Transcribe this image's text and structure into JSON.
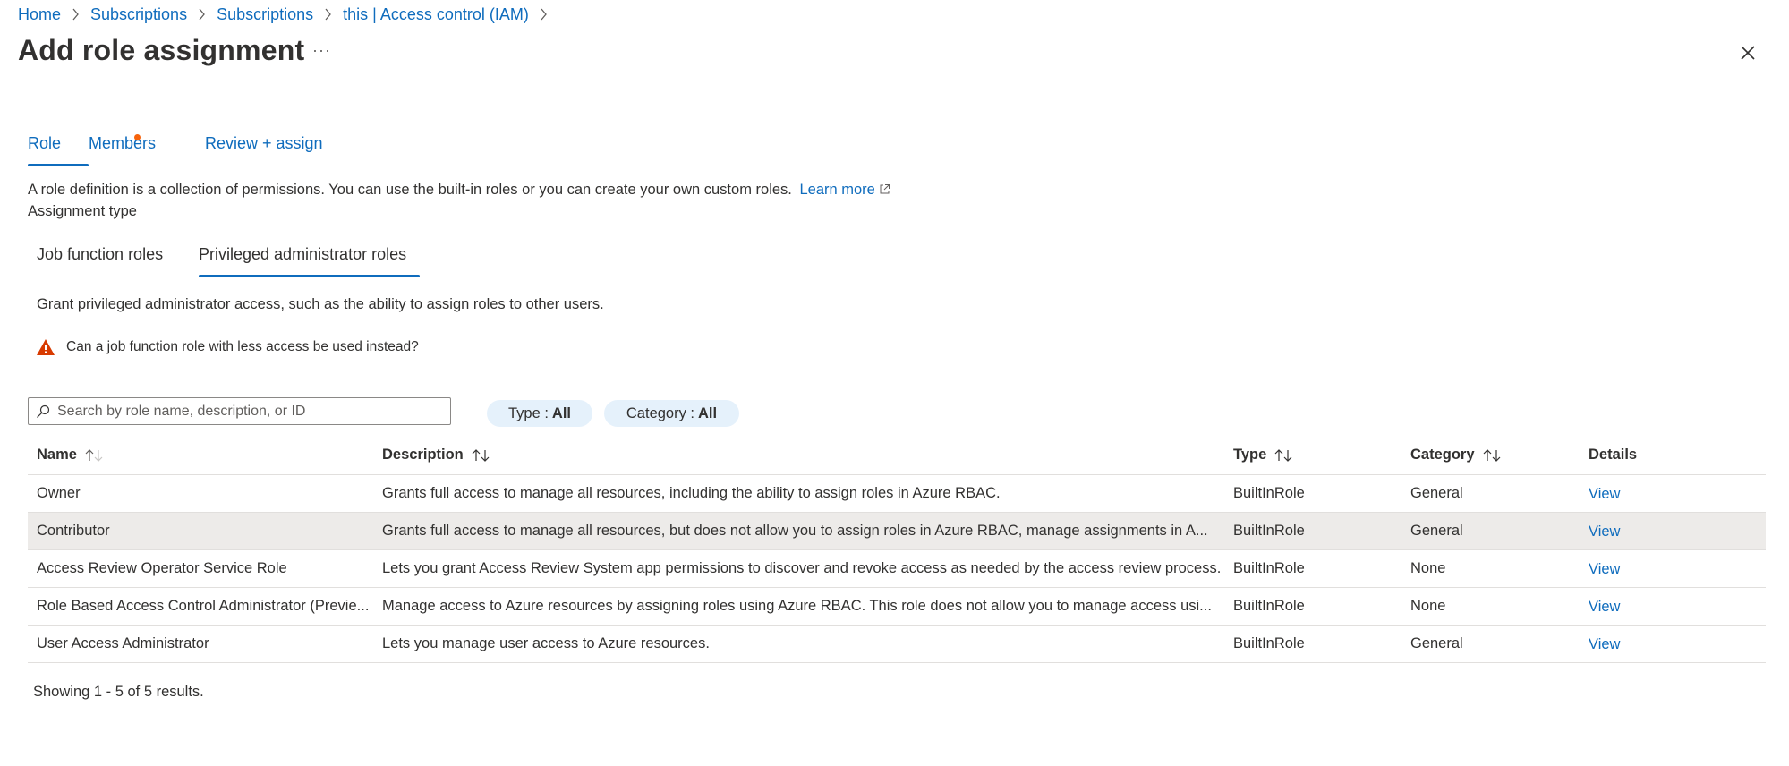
{
  "breadcrumb": {
    "items": [
      "Home",
      "Subscriptions",
      "Subscriptions",
      "this | Access control (IAM)"
    ]
  },
  "page": {
    "title": "Add role assignment",
    "more_label": "···"
  },
  "tabs": [
    {
      "label": "Role",
      "active": true
    },
    {
      "label": "Members",
      "has_indicator": true
    },
    {
      "label": "Review + assign"
    }
  ],
  "description": {
    "text": "A role definition is a collection of permissions. You can use the built-in roles or you can create your own custom roles.",
    "link": "Learn more"
  },
  "assignment_type_label": "Assignment type",
  "subtabs": [
    {
      "label": "Job function roles",
      "active": false
    },
    {
      "label": "Privileged administrator roles",
      "active": true
    }
  ],
  "grant_text": "Grant privileged administrator access, such as the ability to assign roles to other users.",
  "warning_text": "Can a job function role with less access be used instead?",
  "search": {
    "placeholder": "Search by role name, description, or ID",
    "value": ""
  },
  "filters": {
    "type": {
      "label": "Type :",
      "value": "All"
    },
    "category": {
      "label": "Category :",
      "value": "All"
    }
  },
  "table": {
    "headers": {
      "name": "Name",
      "description": "Description",
      "type": "Type",
      "category": "Category",
      "details": "Details"
    },
    "rows": [
      {
        "name": "Owner",
        "description": "Grants full access to manage all resources, including the ability to assign roles in Azure RBAC.",
        "type": "BuiltInRole",
        "category": "General",
        "details": "View"
      },
      {
        "name": "Contributor",
        "description": "Grants full access to manage all resources, but does not allow you to assign roles in Azure RBAC, manage assignments in A...",
        "type": "BuiltInRole",
        "category": "General",
        "details": "View",
        "selected": true
      },
      {
        "name": "Access Review Operator Service Role",
        "description": "Lets you grant Access Review System app permissions to discover and revoke access as needed by the access review process.",
        "type": "BuiltInRole",
        "category": "None",
        "details": "View"
      },
      {
        "name": "Role Based Access Control Administrator (Previe...",
        "description": "Manage access to Azure resources by assigning roles using Azure RBAC. This role does not allow you to manage access usi...",
        "type": "BuiltInRole",
        "category": "None",
        "details": "View"
      },
      {
        "name": "User Access Administrator",
        "description": "Lets you manage user access to Azure resources.",
        "type": "BuiltInRole",
        "category": "General",
        "details": "View"
      }
    ]
  },
  "results_text": "Showing 1 - 5 of 5 results.",
  "colors": {
    "accent": "#0f6cbd",
    "indicator": "#f7630c",
    "warning": "#d83b01",
    "selected_row": "#edebe9",
    "pill_bg": "#e5f1fb"
  }
}
